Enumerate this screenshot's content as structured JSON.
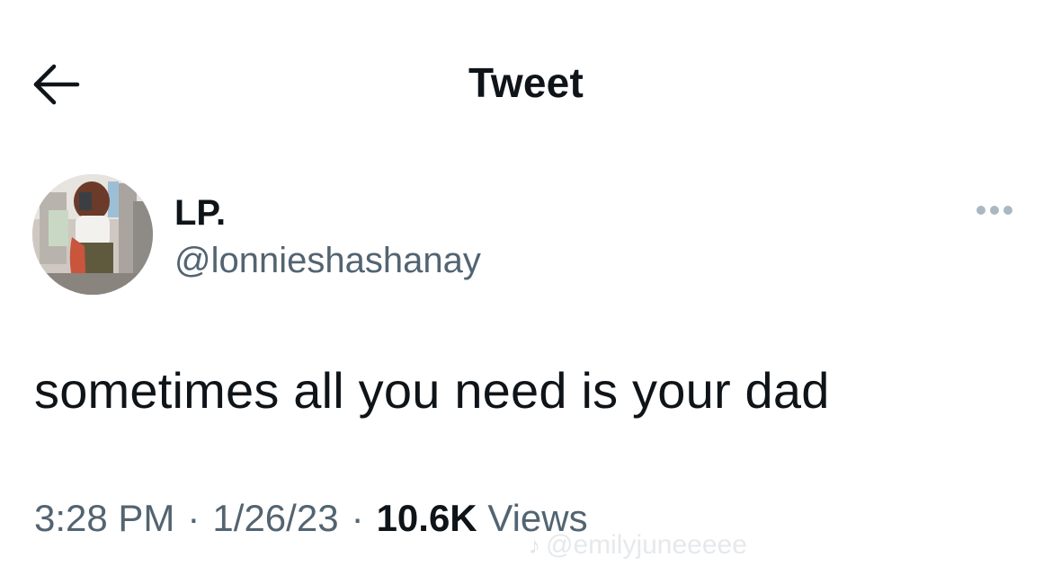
{
  "header": {
    "title": "Tweet",
    "back_icon": "arrow-left-icon"
  },
  "author": {
    "display_name": "LP.",
    "handle": "@lonnieshashanay",
    "avatar_icon": "profile-photo"
  },
  "more_icon": "more-horizontal-icon",
  "tweet": {
    "text": "sometimes all you need is your dad"
  },
  "meta": {
    "time": "3:28 PM",
    "separator": "·",
    "date": "1/26/23",
    "views_count": "10.6K",
    "views_label": "Views"
  },
  "watermark": {
    "icon": "♪",
    "text": "@emilyjuneeeee"
  },
  "colors": {
    "text_primary": "#0f1419",
    "text_secondary": "#536471",
    "background": "#ffffff",
    "more_dots": "#aab8c2"
  }
}
